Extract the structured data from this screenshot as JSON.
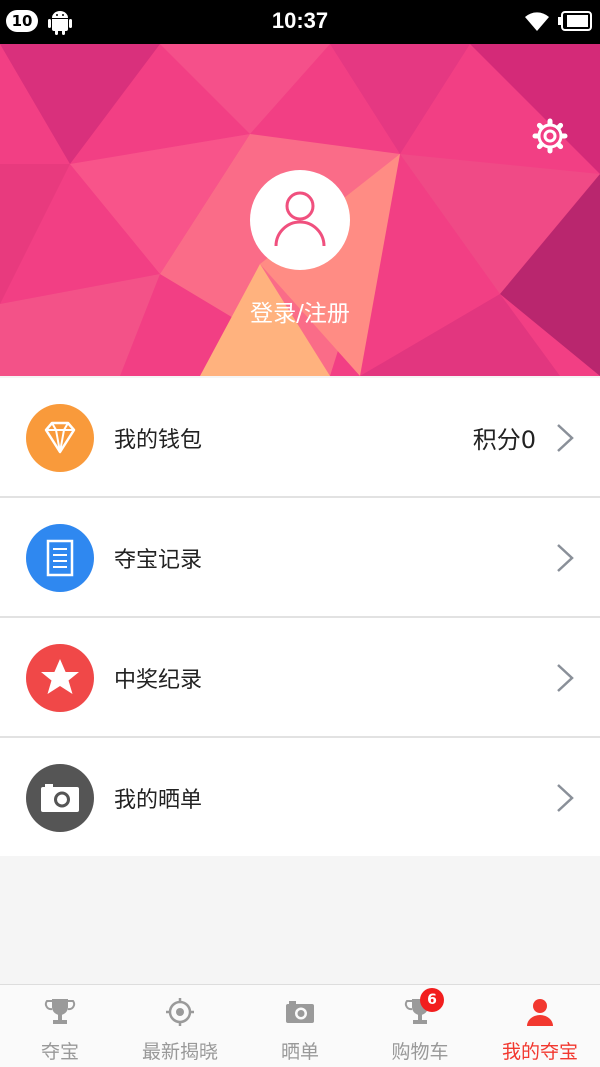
{
  "status_bar": {
    "notification_count": "10",
    "time": "10:37"
  },
  "header": {
    "login_label": "登录/注册"
  },
  "menu": {
    "items": [
      {
        "label": "我的钱包",
        "value": "积分0",
        "icon": "diamond-icon",
        "color": "#f99a3b"
      },
      {
        "label": "夺宝记录",
        "value": "",
        "icon": "document-icon",
        "color": "#2f88f0"
      },
      {
        "label": "中奖纪录",
        "value": "",
        "icon": "star-icon",
        "color": "#f04848"
      },
      {
        "label": "我的晒单",
        "value": "",
        "icon": "camera-icon",
        "color": "#555555"
      }
    ]
  },
  "tabbar": {
    "tabs": [
      {
        "label": "夺宝",
        "icon": "trophy-icon"
      },
      {
        "label": "最新揭晓",
        "icon": "target-icon"
      },
      {
        "label": "晒单",
        "icon": "camera-icon"
      },
      {
        "label": "购物车",
        "icon": "cart-trophy-icon",
        "badge": "6"
      },
      {
        "label": "我的夺宝",
        "icon": "user-icon",
        "active": true
      }
    ]
  },
  "colors": {
    "accent": "#f2382f",
    "header": "#f23d82"
  }
}
